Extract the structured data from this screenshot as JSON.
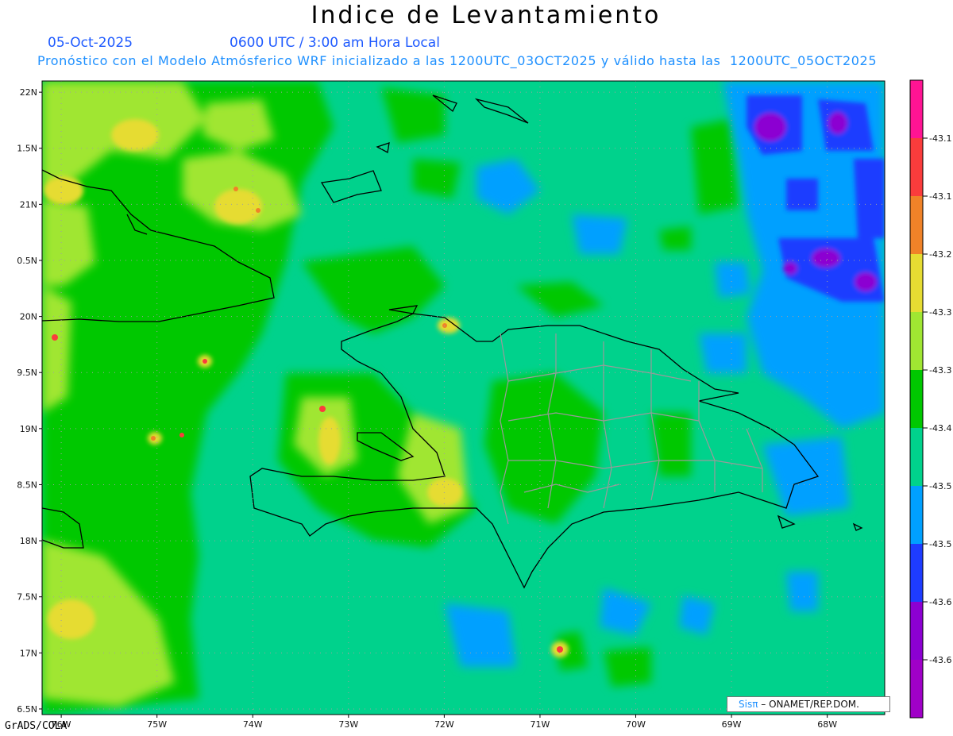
{
  "title": "Indice de Levantamiento",
  "header": {
    "date": "05-Oct-2025",
    "time": "0600 UTC / 3:00 am Hora Local",
    "description": "Pronóstico con el Modelo Atmósferico WRF inicializado a las 1200UTC_03OCT2025 y válido hasta las  1200UTC_05OCT2025"
  },
  "map": {
    "lon_range": [
      -76.2,
      -67.4
    ],
    "lat_range": [
      16.45,
      22.1
    ],
    "lat_ticks": [
      "22N",
      "21.5N",
      "21N",
      "20.5N",
      "20N",
      "19.5N",
      "19N",
      "18.5N",
      "18N",
      "17.5N",
      "17N",
      "16.5N"
    ],
    "lat_tick_labels_visible": [
      "22N",
      "1.5N",
      "21N",
      "0.5N",
      "20N",
      "9.5N",
      "19N",
      "8.5N",
      "18N",
      "7.5N",
      "17N",
      "6.5N"
    ],
    "lon_ticks": [
      "76W",
      "75W",
      "74W",
      "73W",
      "72W",
      "71W",
      "70W",
      "69W",
      "68W"
    ],
    "background_color": "#00d28c",
    "grid": "dotted"
  },
  "colorbar": {
    "labels": [
      "-43.1",
      "-43.1",
      "-43.2",
      "-43.3",
      "-43.3",
      "-43.4",
      "-43.5",
      "-43.5",
      "-43.6",
      "-43.6"
    ],
    "colors": [
      "#ff1493",
      "#fa3c3c",
      "#f08228",
      "#e6dc32",
      "#a0e632",
      "#00c800",
      "#00d28c",
      "#00a0ff",
      "#1e3cff",
      "#8c00d2",
      "#a000c8"
    ]
  },
  "credit": "GrADS/COLA",
  "watermark": {
    "brand": "Sisπ",
    "org": " – ONAMET/REP.DOM."
  }
}
